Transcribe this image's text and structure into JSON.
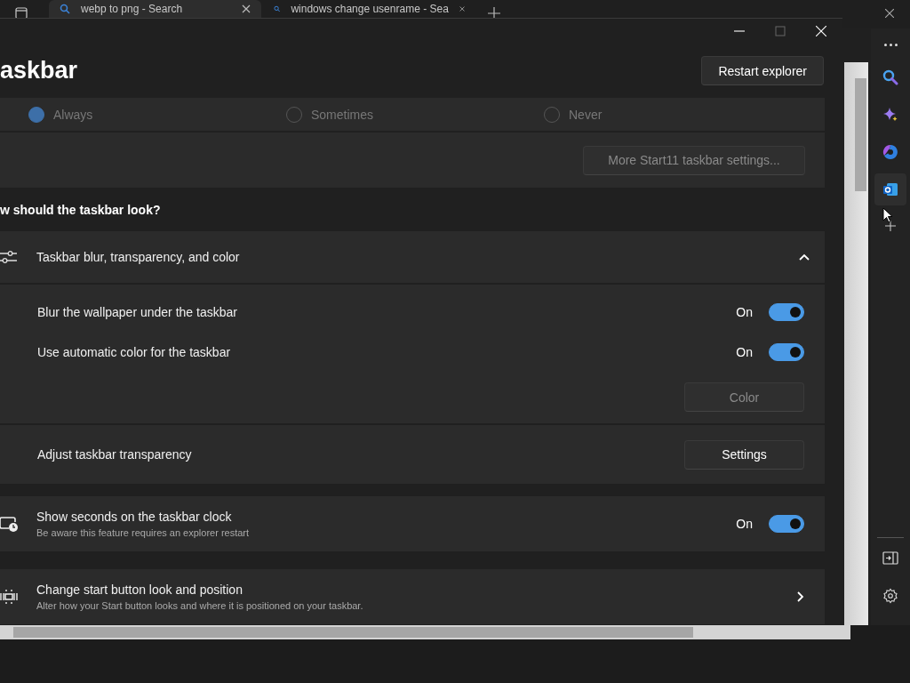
{
  "browser": {
    "tabs": [
      {
        "title": "webp to png - Search",
        "selected": true
      },
      {
        "title": "windows change usenrame - Sea",
        "selected": false
      }
    ]
  },
  "window": {
    "title": "askbar",
    "restart_button": "Restart explorer"
  },
  "visibility_options": [
    {
      "label": "Always",
      "selected": true
    },
    {
      "label": "Sometimes",
      "selected": false
    },
    {
      "label": "Never",
      "selected": false
    }
  ],
  "more_settings_button": {
    "label": "More Start11 taskbar settings...",
    "disabled": true
  },
  "section_heading": "w should the taskbar look?",
  "appearance_group": {
    "title": "Taskbar blur, transparency, and color",
    "expanded": true,
    "rows": [
      {
        "kind": "toggle",
        "label": "Blur the wallpaper under the taskbar",
        "state": "On",
        "on": true
      },
      {
        "kind": "toggle",
        "label": "Use automatic color for the taskbar",
        "state": "On",
        "on": true
      },
      {
        "kind": "button",
        "button": "Color",
        "disabled": true
      }
    ]
  },
  "transparency": {
    "label": "Adjust taskbar transparency",
    "button": "Settings"
  },
  "cards": [
    {
      "kind": "toggle",
      "title": "Show seconds on the taskbar clock",
      "subtitle": "Be aware this feature requires an explorer restart",
      "state": "On",
      "on": true
    },
    {
      "kind": "link",
      "title": "Change start button look and position",
      "subtitle": "Alter how your Start button looks and where it is positioned on your taskbar."
    }
  ]
}
